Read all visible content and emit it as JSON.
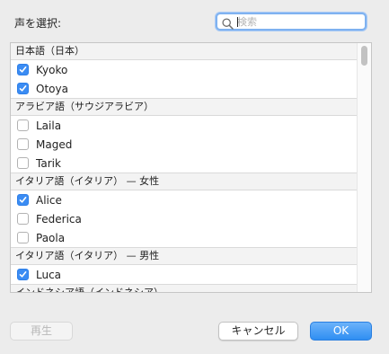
{
  "dialog": {
    "prompt": "声を選択:",
    "search": {
      "placeholder": "検索",
      "value": ""
    }
  },
  "voice_list": {
    "groups": [
      {
        "header": "日本語（日本）",
        "voices": [
          {
            "name": "Kyoko",
            "checked": true
          },
          {
            "name": "Otoya",
            "checked": true
          }
        ]
      },
      {
        "header": "アラビア語（サウジアラビア）",
        "voices": [
          {
            "name": "Laila",
            "checked": false
          },
          {
            "name": "Maged",
            "checked": false
          },
          {
            "name": "Tarik",
            "checked": false
          }
        ]
      },
      {
        "header": "イタリア語（イタリア） — 女性",
        "voices": [
          {
            "name": "Alice",
            "checked": true
          },
          {
            "name": "Federica",
            "checked": false
          },
          {
            "name": "Paola",
            "checked": false
          }
        ]
      },
      {
        "header": "イタリア語（イタリア） — 男性",
        "voices": [
          {
            "name": "Luca",
            "checked": true
          }
        ]
      },
      {
        "header": "インドネシア語（インドネシア）",
        "voices": []
      }
    ]
  },
  "buttons": {
    "play": "再生",
    "cancel": "キャンセル",
    "ok": "OK"
  },
  "colors": {
    "accent": "#3b8cf3",
    "focus_ring": "#7fb2f0"
  }
}
